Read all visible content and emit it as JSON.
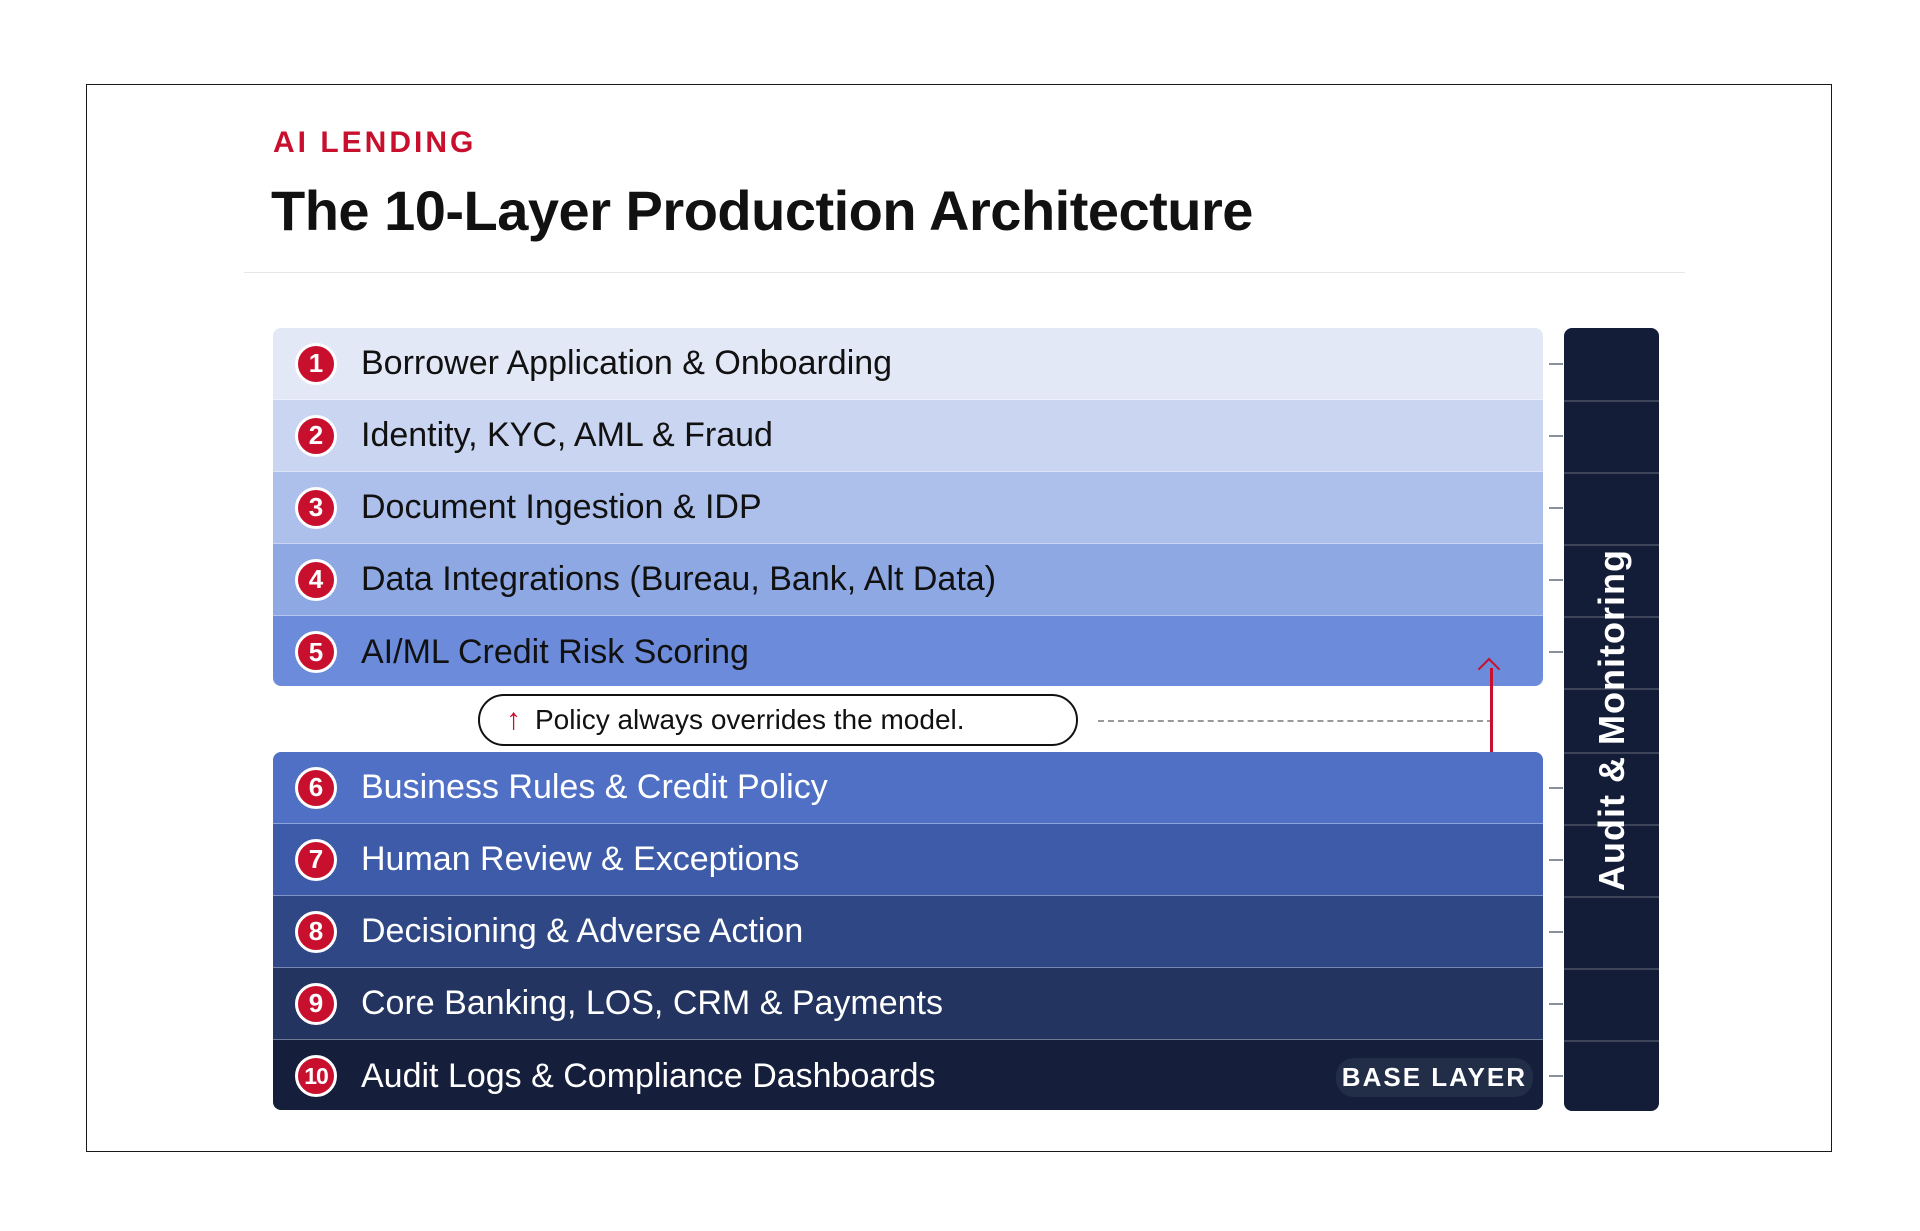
{
  "header": {
    "eyebrow": "AI LENDING",
    "title": "The 10-Layer Production Architecture"
  },
  "layers_top": [
    {
      "num": "1",
      "label": "Borrower Application & Onboarding",
      "color": "#e3e8f7"
    },
    {
      "num": "2",
      "label": "Identity, KYC, AML & Fraud",
      "color": "#cad5f1"
    },
    {
      "num": "3",
      "label": "Document Ingestion & IDP",
      "color": "#adbfeb"
    },
    {
      "num": "4",
      "label": "Data Integrations (Bureau, Bank, Alt Data)",
      "color": "#8ea8e3"
    },
    {
      "num": "5",
      "label": "AI/ML Credit Risk Scoring",
      "color": "#6c8cdb"
    }
  ],
  "layers_bottom": [
    {
      "num": "6",
      "label": "Business Rules & Credit Policy",
      "color": "#4f70c4"
    },
    {
      "num": "7",
      "label": "Human Review & Exceptions",
      "color": "#3d5ba8"
    },
    {
      "num": "8",
      "label": "Decisioning & Adverse Action",
      "color": "#2f4785"
    },
    {
      "num": "9",
      "label": "Core Banking, LOS, CRM & Payments",
      "color": "#22345f"
    },
    {
      "num": "10",
      "label": "Audit Logs & Compliance Dashboards",
      "color": "#151e3a",
      "tag": "BASE LAYER"
    }
  ],
  "policy_note": {
    "text": "Policy always overrides the model.",
    "arrow_icon": "arrow-up-icon",
    "accent": "#c8102e"
  },
  "sidebar": {
    "label": "Audit & Monitoring",
    "color": "#141d38"
  },
  "colors": {
    "accent": "#c8102e",
    "badge_fill": "#c8102e"
  }
}
